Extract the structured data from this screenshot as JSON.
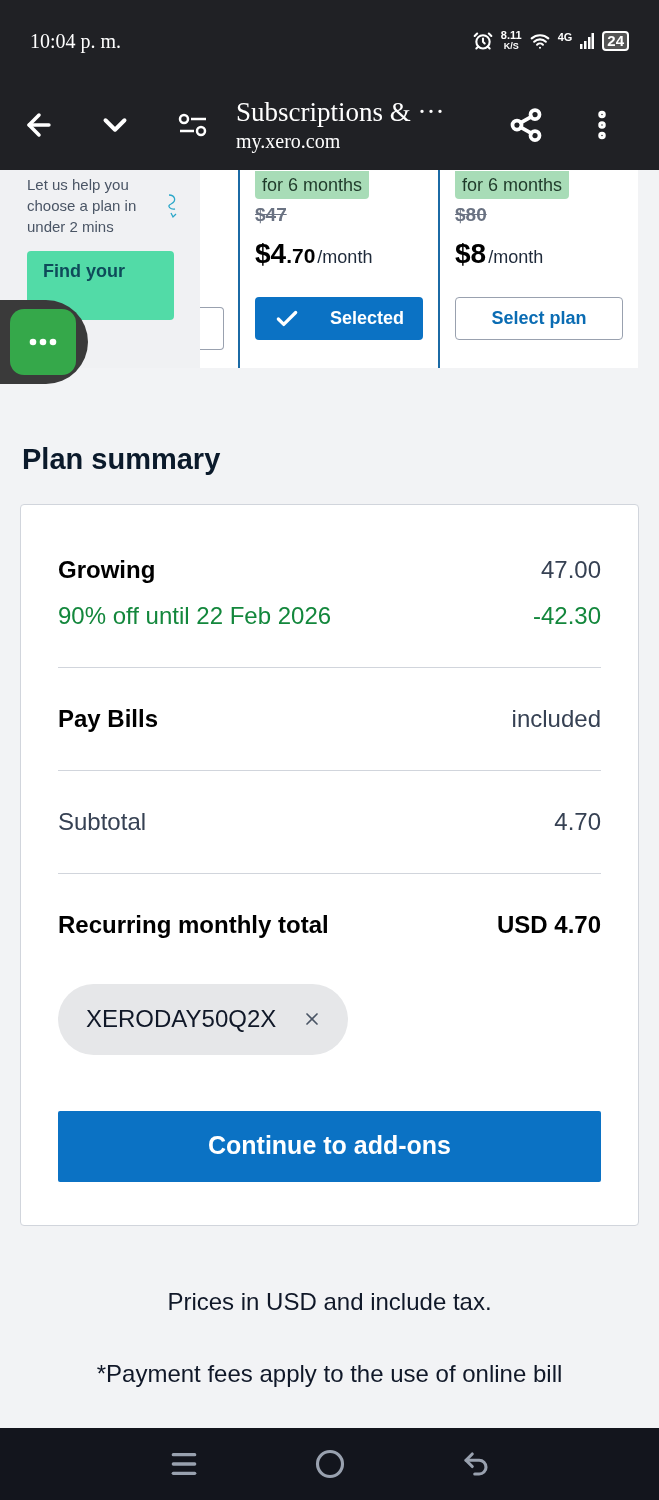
{
  "status_bar": {
    "time": "10:04 p. m.",
    "net_speed": "8.11",
    "net_unit": "K/S",
    "network": "4G",
    "battery": "24"
  },
  "toolbar": {
    "title": "Subscriptions & ···",
    "url": "my.xero.com"
  },
  "helper": {
    "text": "Let us help you choose a plan in under 2 mins",
    "button": "Find your"
  },
  "plans": [
    {
      "kind": "partial"
    },
    {
      "kind": "plan",
      "badge": "for 6 months",
      "old_price": "$47",
      "price": "$4",
      "cents": ".70",
      "period": "/month",
      "button": "Selected",
      "selected": true
    },
    {
      "kind": "plan",
      "badge": "for 6 months",
      "old_price": "$80",
      "price": "$8",
      "period": "/month",
      "button": "Select plan",
      "selected": false
    }
  ],
  "summary": {
    "title": "Plan summary",
    "lines": [
      {
        "kind": "plan",
        "label": "Growing",
        "amount": "47.00",
        "discount_label": "90% off until 22 Feb 2026",
        "discount_amount": "-42.30"
      },
      {
        "kind": "item",
        "label": "Pay Bills",
        "amount": "included"
      },
      {
        "kind": "subtotal",
        "label": "Subtotal",
        "amount": "4.70"
      },
      {
        "kind": "total",
        "label": "Recurring monthly total",
        "amount": "USD 4.70"
      }
    ],
    "promo_code": "XERODAY50Q2X",
    "button": "Continue to add-ons"
  },
  "notes": [
    "Prices in USD and include tax.",
    "*Payment fees apply to the use of online bill"
  ]
}
